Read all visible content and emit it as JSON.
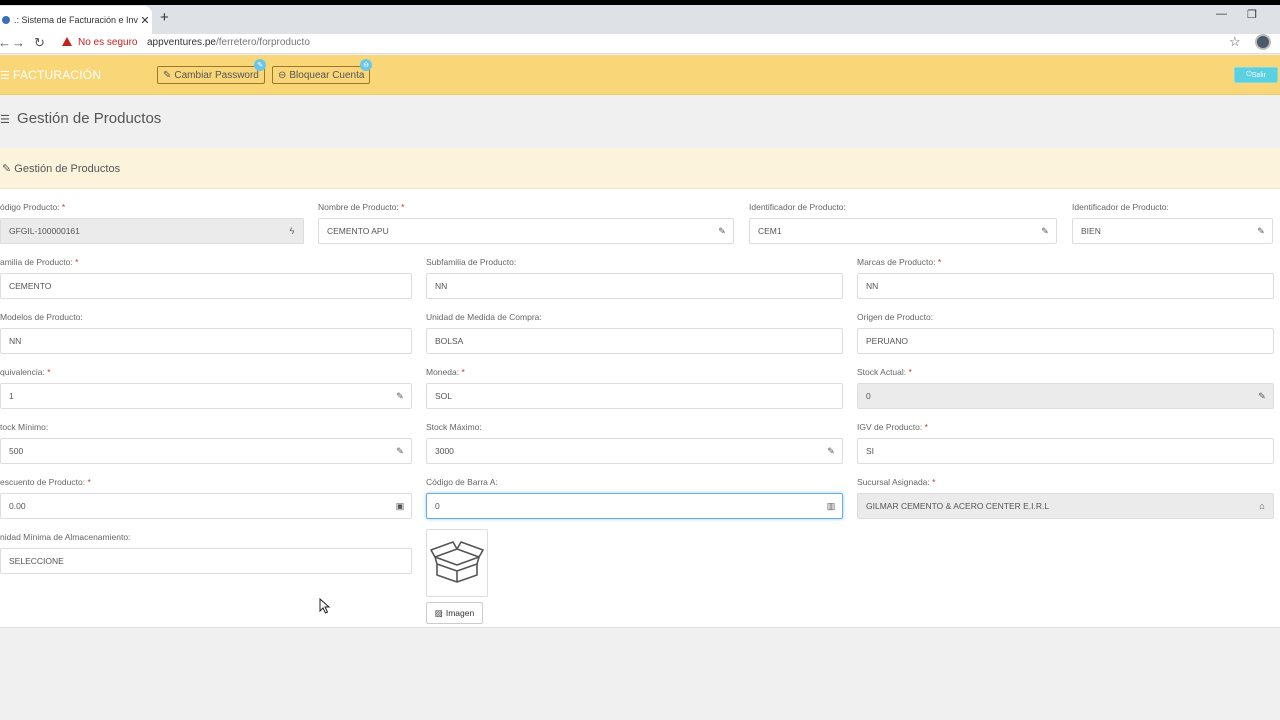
{
  "browser": {
    "tab_title": ".: Sistema de Facturación e Inventario",
    "tab_close": "✕",
    "new_tab": "+",
    "not_secure": "No es seguro",
    "url_host": "appventures.pe",
    "url_path": "/ferretero/forproducto"
  },
  "header": {
    "brand": "FACTURACIÓN",
    "change_password": "Cambiar Password",
    "lock_account": "Bloquear Cuenta",
    "logout": "Salir"
  },
  "page": {
    "title": "Gestión de Productos",
    "panel_title": "Gestión de Productos"
  },
  "form": {
    "codigo": {
      "label": "ódigo Producto:",
      "req": "*",
      "value": "GFGIL-100000161"
    },
    "nombre": {
      "label": "Nombre de Producto:",
      "req": "*",
      "value": "CEMENTO APU"
    },
    "ident1": {
      "label": "Identificador de Producto:",
      "value": "CEM1"
    },
    "ident2": {
      "label": "Identificador de Producto:",
      "value": "BIEN"
    },
    "familia": {
      "label": "amilia de Producto:",
      "req": "*",
      "value": "CEMENTO"
    },
    "subfamilia": {
      "label": "Subfamilia de Producto:",
      "value": "NN"
    },
    "marcas": {
      "label": "Marcas de Producto:",
      "req": "*",
      "value": "NN"
    },
    "modelos": {
      "label": "Modelos de Producto:",
      "value": "NN"
    },
    "unidad_compra": {
      "label": "Unidad de Medida de Compra:",
      "value": "BOLSA"
    },
    "origen": {
      "label": "Origen de Producto:",
      "value": "PERUANO"
    },
    "equivalencia": {
      "label": "quivalencia:",
      "req": "*",
      "value": "1"
    },
    "moneda": {
      "label": "Moneda:",
      "req": "*",
      "value": "SOL"
    },
    "stock_actual": {
      "label": "Stock Actual:",
      "req": "*",
      "value": "0"
    },
    "stock_min": {
      "label": "tock Mínimo:",
      "value": "500"
    },
    "stock_max": {
      "label": "Stock Máximo:",
      "value": "3000"
    },
    "igv": {
      "label": "IGV de Producto:",
      "req": "*",
      "value": "SI"
    },
    "descuento": {
      "label": "escuento de Producto:",
      "req": "*",
      "value": "0.00"
    },
    "codigo_barra": {
      "label": "Código de Barra A:",
      "value": "0"
    },
    "sucursal": {
      "label": "Sucursal Asignada:",
      "req": "*",
      "value": "GILMAR CEMENTO & ACERO CENTER E.I.R.L"
    },
    "unidad_min": {
      "label": "nidad Mínima de Almacenamiento:",
      "value": "SELECCIONE"
    },
    "imagen_button": "Imagen"
  }
}
